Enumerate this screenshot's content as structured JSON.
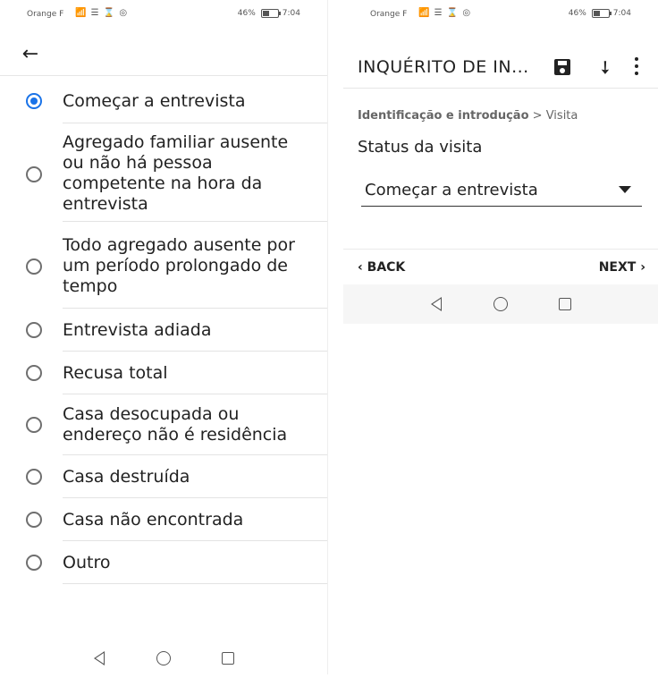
{
  "left": {
    "status": {
      "carrier": "Orange F",
      "battery_text": "46%",
      "time": "7:04",
      "battery_level": 0.46
    },
    "options": [
      {
        "label": "Começar a entrevista",
        "checked": true
      },
      {
        "label": "Agregado familiar ausente ou não há pessoa competente na hora da entrevista",
        "checked": false
      },
      {
        "label": "Todo agregado ausente por um período prolongado de tempo",
        "checked": false
      },
      {
        "label": "Entrevista adiada",
        "checked": false
      },
      {
        "label": "Recusa total",
        "checked": false
      },
      {
        "label": "Casa desocupada ou endereço não é residência",
        "checked": false
      },
      {
        "label": "Casa destruída",
        "checked": false
      },
      {
        "label": "Casa não encontrada",
        "checked": false
      },
      {
        "label": "Outro",
        "checked": false
      }
    ]
  },
  "right": {
    "status": {
      "carrier": "Orange F",
      "battery_text": "46%",
      "time": "7:04",
      "battery_level": 0.46
    },
    "appbar": {
      "title": "INQUÉRITO DE IN..."
    },
    "breadcrumb": {
      "section": "Identificação e introdução",
      "separator": ">",
      "page": "Visita"
    },
    "question": "Status da visita",
    "select_value": "Começar a entrevista",
    "nav": {
      "back": "BACK",
      "next": "NEXT"
    }
  },
  "icons": {
    "back": "arrow-left-icon",
    "save": "save-icon",
    "jump": "jump-icon",
    "more": "more-vert-icon",
    "nav_back": "triangle-back-icon",
    "nav_home": "circle-home-icon",
    "nav_recent": "square-recent-icon"
  },
  "colors": {
    "accent": "#1a73e8"
  }
}
